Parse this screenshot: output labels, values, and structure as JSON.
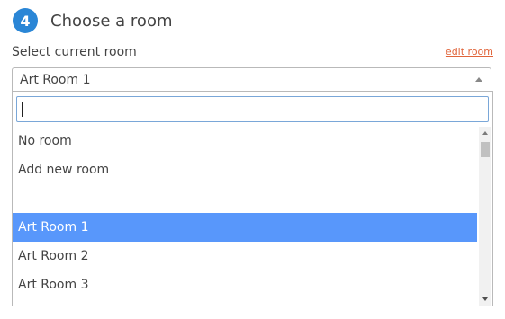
{
  "step": {
    "number": "4",
    "title": "Choose a room"
  },
  "field": {
    "label": "Select current room",
    "edit_link": "edit room"
  },
  "select": {
    "value": "Art Room 1",
    "search_value": ""
  },
  "options": [
    {
      "label": "No room"
    },
    {
      "label": "Add new room"
    },
    {
      "label": "----------------"
    },
    {
      "label": "Art Room 1"
    },
    {
      "label": "Art Room 2"
    },
    {
      "label": "Art Room 3"
    }
  ],
  "colors": {
    "badge": "#2a86d6",
    "link": "#e0643a",
    "highlight": "#5897fb"
  }
}
